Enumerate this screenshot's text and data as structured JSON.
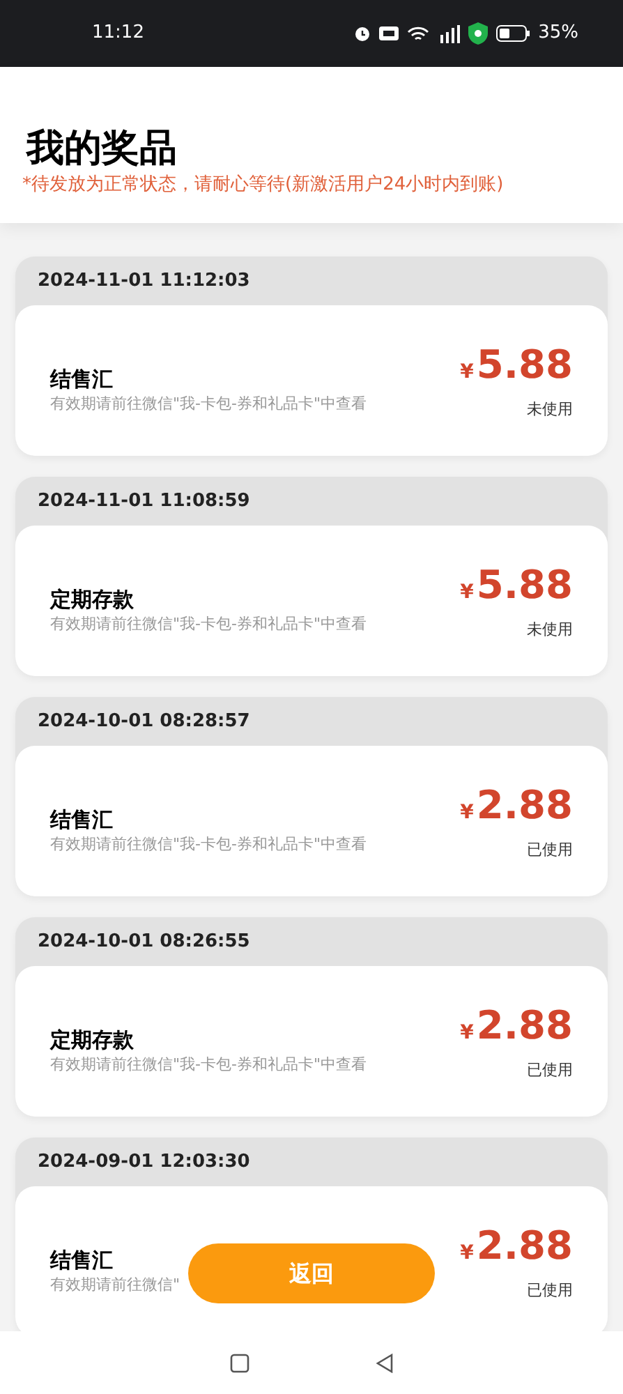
{
  "status_bar": {
    "time": "11:12",
    "battery": "35%"
  },
  "header": {
    "title": "我的奖品",
    "notice": "*待发放为正常状态，请耐心等待(新激活用户24小时内到账)"
  },
  "prizes": [
    {
      "date": "2024-11-01 11:12:03",
      "name": "结售汇",
      "hint": "有效期请前往微信\"我-卡包-券和礼品卡\"中查看",
      "currency": "¥",
      "amount": "5.88",
      "status": "未使用"
    },
    {
      "date": "2024-11-01 11:08:59",
      "name": "定期存款",
      "hint": "有效期请前往微信\"我-卡包-券和礼品卡\"中查看",
      "currency": "¥",
      "amount": "5.88",
      "status": "未使用"
    },
    {
      "date": "2024-10-01 08:28:57",
      "name": "结售汇",
      "hint": "有效期请前往微信\"我-卡包-券和礼品卡\"中查看",
      "currency": "¥",
      "amount": "2.88",
      "status": "已使用"
    },
    {
      "date": "2024-10-01 08:26:55",
      "name": "定期存款",
      "hint": "有效期请前往微信\"我-卡包-券和礼品卡\"中查看",
      "currency": "¥",
      "amount": "2.88",
      "status": "已使用"
    },
    {
      "date": "2024-09-01 12:03:30",
      "name": "结售汇",
      "hint": "有效期请前往微信\"",
      "currency": "¥",
      "amount": "2.88",
      "status": "已使用"
    }
  ],
  "back_button": "返回"
}
